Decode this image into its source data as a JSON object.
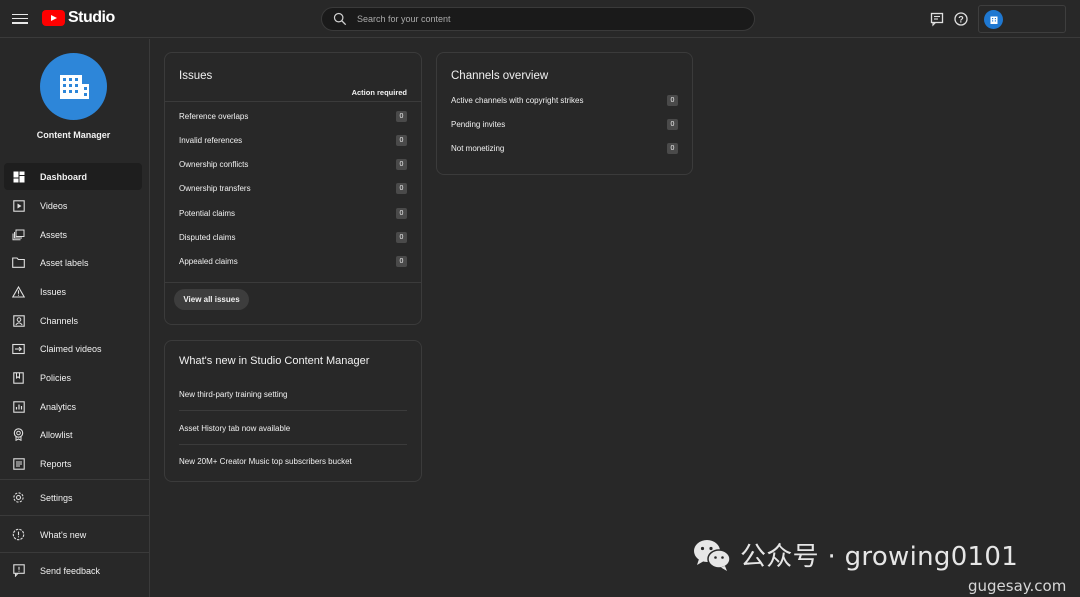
{
  "header": {
    "logo_text": "Studio",
    "search_placeholder": "Search for your content",
    "icons": [
      "menu-icon",
      "feedback-icon",
      "help-icon",
      "account-icon"
    ]
  },
  "sidebar": {
    "channel_name": "Content Manager",
    "items": [
      {
        "label": "Dashboard",
        "icon": "dashboard-icon",
        "active": true
      },
      {
        "label": "Videos",
        "icon": "videos-icon"
      },
      {
        "label": "Assets",
        "icon": "assets-icon"
      },
      {
        "label": "Asset labels",
        "icon": "folder-icon"
      },
      {
        "label": "Issues",
        "icon": "warning-icon"
      },
      {
        "label": "Channels",
        "icon": "channel-icon"
      },
      {
        "label": "Claimed videos",
        "icon": "claimed-icon"
      },
      {
        "label": "Policies",
        "icon": "policy-icon"
      },
      {
        "label": "Analytics",
        "icon": "analytics-icon"
      },
      {
        "label": "Allowlist",
        "icon": "badge-icon"
      },
      {
        "label": "Reports",
        "icon": "reports-icon"
      }
    ],
    "footer_items": [
      {
        "label": "Settings",
        "icon": "gear-icon"
      },
      {
        "label": "What's new",
        "icon": "whats-new-icon"
      },
      {
        "label": "Send feedback",
        "icon": "send-feedback-icon"
      }
    ]
  },
  "issues": {
    "title": "Issues",
    "column_header": "Action required",
    "rows": [
      {
        "label": "Reference overlaps",
        "count": "0"
      },
      {
        "label": "Invalid references",
        "count": "0"
      },
      {
        "label": "Ownership conflicts",
        "count": "0"
      },
      {
        "label": "Ownership transfers",
        "count": "0"
      },
      {
        "label": "Potential claims",
        "count": "0"
      },
      {
        "label": "Disputed claims",
        "count": "0"
      },
      {
        "label": "Appealed claims",
        "count": "0"
      }
    ],
    "button_label": "View all issues"
  },
  "channels_overview": {
    "title": "Channels overview",
    "rows": [
      {
        "label": "Active channels with copyright strikes",
        "count": "0"
      },
      {
        "label": "Pending invites",
        "count": "0"
      },
      {
        "label": "Not monetizing",
        "count": "0"
      }
    ]
  },
  "whats_new": {
    "title": "What's new in Studio Content Manager",
    "items": [
      "New third-party training setting",
      "Asset History tab now available",
      "New 20M+ Creator Music top subscribers bucket"
    ]
  },
  "watermark": {
    "text": "公众号 · growing0101",
    "domain": "gugesay.com"
  },
  "colors": {
    "background": "#282828",
    "youtube_red": "#ff0000",
    "avatar_blue": "#2d86d9",
    "card_border": "#3b3b3b"
  }
}
